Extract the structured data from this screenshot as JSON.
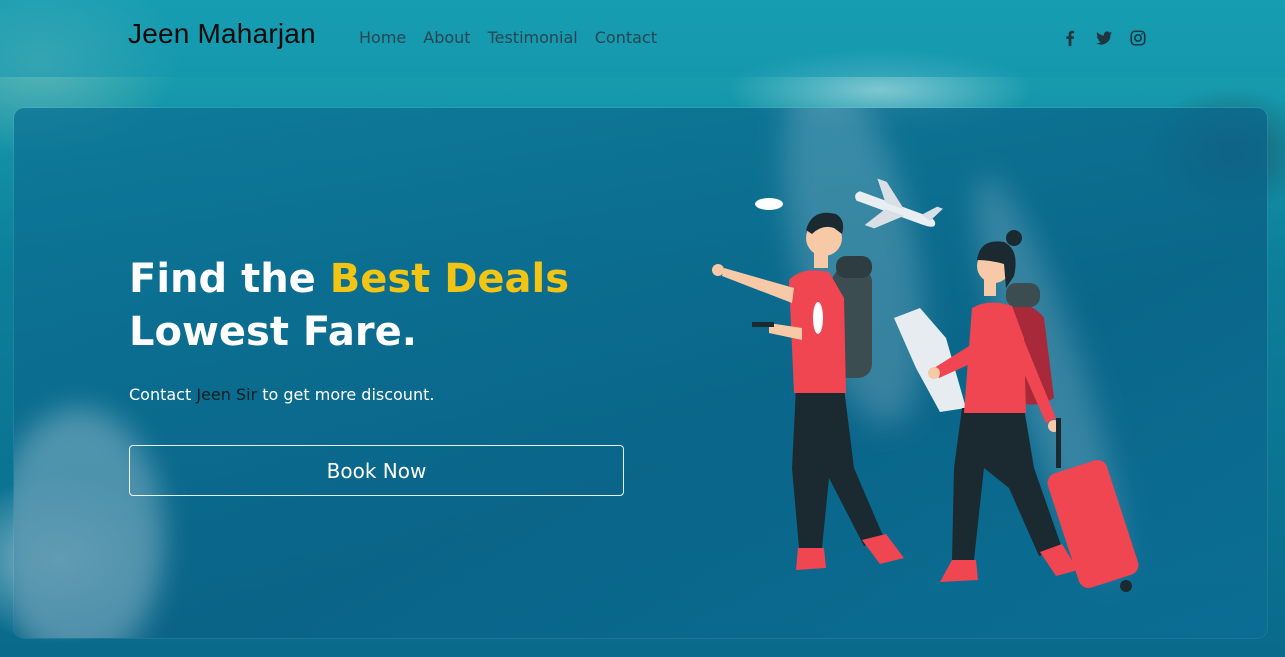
{
  "nav": {
    "brand": "Jeen Maharjan",
    "links": [
      "Home",
      "About",
      "Testimonial",
      "Contact"
    ],
    "socials": [
      "facebook-icon",
      "twitter-icon",
      "instagram-icon"
    ]
  },
  "hero": {
    "headline_part1": "Find the ",
    "headline_accent": "Best Deals",
    "headline_line2": "Lowest Fare.",
    "sub_before": "Contact ",
    "sub_name": "Jeen Sir",
    "sub_after": " to get more discount.",
    "cta": "Book Now"
  },
  "colors": {
    "accent": "#f2c414",
    "text": "#ffffff",
    "nav_text": "#2a4550",
    "traveler_red": "#ef4651",
    "dark_pants": "#1b2a30"
  }
}
